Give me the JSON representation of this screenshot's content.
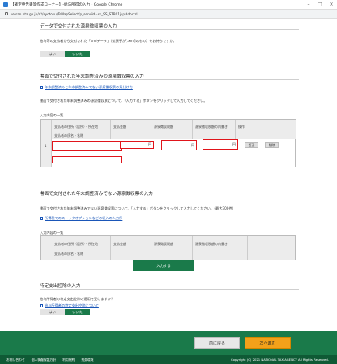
{
  "window": {
    "title": "【確定申告書等作成コーナー】-給与所得の入力 - Google Chrome"
  },
  "address": {
    "url": "keisan.nta.go.jp/r2/syotoku/TsMapSelect/p_serviId=ss_SS_STB01jsp#doctrl"
  },
  "section_data": {
    "title": "データで交付された源泉徴収票の入力",
    "description": "給与等の支払者から交付された「xmlデータ」（拡張子が[.xml]のもの）をお持ちですか。",
    "yes": "はい",
    "no": "いいえ"
  },
  "section_paper_adjusted": {
    "title": "書面で交付された年末調整済みの源泉徴収票の入力",
    "link": "年末調整済みと年末調整済みでない源泉徴収票の見分け方",
    "instruction": "書面で交付された年末調整済みの源泉徴収票について、「入力する」ボタンをクリックして入力してください。",
    "list_title": "入力内容の一覧",
    "headers": {
      "payer_address": "支払者の住所（居所）・所在地",
      "payer_name": "支払者の氏名・名称",
      "amount": "支払金額",
      "deduction": "源泉徴収税額",
      "deduction_inner": "源泉徴収税額の内書き",
      "ops": "操作"
    },
    "row_number": "1",
    "unit": "円",
    "edit": "訂正",
    "delete": "削除"
  },
  "section_paper_unadjusted": {
    "title": "書面で交付された年末調整済みでない源泉徴収票の入力",
    "instruction": "書面で交付された年末調整済みでない源泉徴収票について、「入力する」ボタンをクリックして入力してください。（最大300件）",
    "link": "所得税でのストックオプションなどの収入の入力例",
    "list_title": "入力内容の一覧",
    "headers": {
      "payer_address": "支払者の住所（居所）・所在地",
      "payer_name": "支払者の氏名・名称",
      "amount": "支払金額",
      "deduction": "源泉徴収税額",
      "deduction_inner": "源泉徴収税額の内書き"
    },
    "input_button": "入力する"
  },
  "section_specific": {
    "title": "特定支出控除の入力",
    "description": "給与所得者の特定支出控除の適用を受けますか？",
    "link": "給与所得者の特定支出控除について",
    "yes": "はい",
    "no": "いいえ"
  },
  "nav": {
    "back": "前に戻る",
    "next": "次へ進む"
  },
  "footer": {
    "links": [
      "お問い合わせ",
      "個人情報保護方針",
      "利用規約",
      "推奨環境"
    ],
    "copyright": "Copyright (C) 2021 NATIONAL TAX AGENCY All Rights Reserved."
  },
  "colors": {
    "brand_green": "#1a7a4a",
    "next_orange": "#f3a11a",
    "error_red": "#e0151b"
  }
}
